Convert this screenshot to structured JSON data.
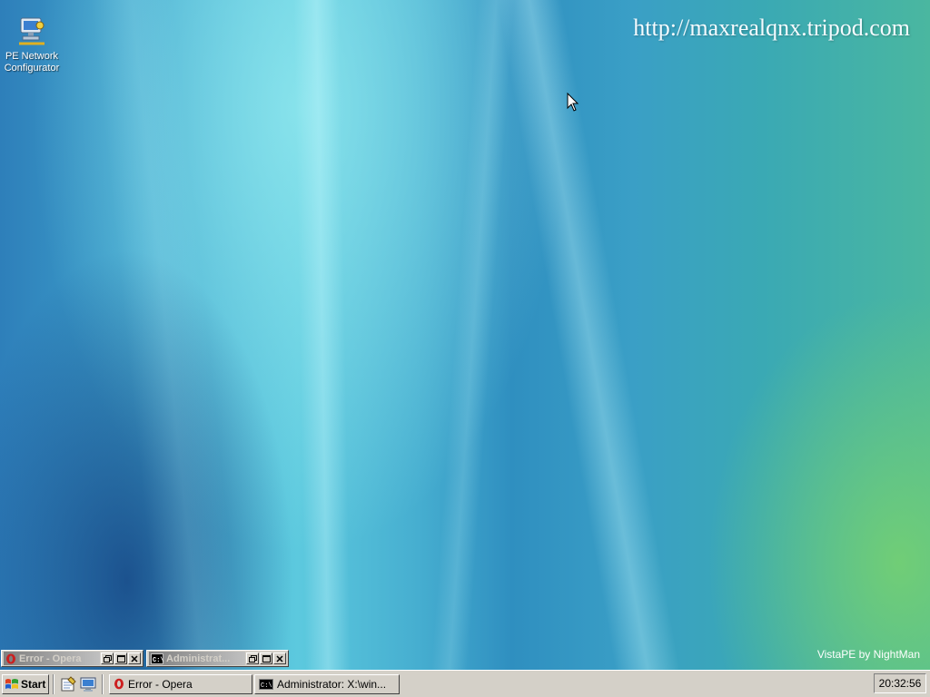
{
  "desktop": {
    "icons": [
      {
        "label": "PE Network Configurator",
        "icon": "network-configurator-icon"
      }
    ],
    "overlay_url": "http://maxrealqnx.tripod.com",
    "brand": "VistaPE by NightMan"
  },
  "minimized_windows": [
    {
      "title": "Error - Opera",
      "icon": "opera-icon"
    },
    {
      "title": "Administrat...",
      "icon": "console-icon"
    }
  ],
  "taskbar": {
    "start_label": "Start",
    "quick_launch": [
      "notepad-icon",
      "show-desktop-icon"
    ],
    "tasks": [
      {
        "label": "Error - Opera",
        "icon": "opera-icon"
      },
      {
        "label": "Administrator: X:\\win...",
        "icon": "console-icon"
      }
    ],
    "clock": "20:32:56"
  },
  "colors": {
    "taskbar_bg": "#d4d0c8",
    "wallpaper_blue": "#3ea3cc",
    "wallpaper_green": "#78d26e"
  }
}
